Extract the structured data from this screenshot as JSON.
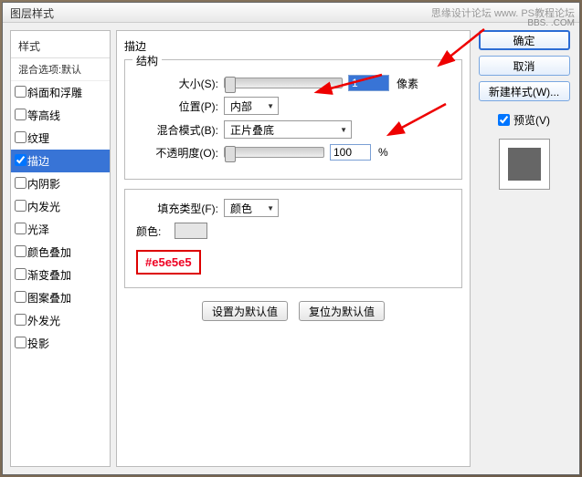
{
  "watermark": "思缘设计论坛  www.  PS教程论坛",
  "watermark2": "BBS.  .COM",
  "title": "图层样式",
  "left": {
    "header": "样式",
    "sub": "混合选项:默认",
    "items": [
      {
        "label": "斜面和浮雕",
        "checked": false
      },
      {
        "label": "等高线",
        "checked": false
      },
      {
        "label": "纹理",
        "checked": false
      },
      {
        "label": "描边",
        "checked": true,
        "selected": true
      },
      {
        "label": "内阴影",
        "checked": false
      },
      {
        "label": "内发光",
        "checked": false
      },
      {
        "label": "光泽",
        "checked": false
      },
      {
        "label": "颜色叠加",
        "checked": false
      },
      {
        "label": "渐变叠加",
        "checked": false
      },
      {
        "label": "图案叠加",
        "checked": false
      },
      {
        "label": "外发光",
        "checked": false
      },
      {
        "label": "投影",
        "checked": false
      }
    ]
  },
  "center": {
    "panel_title": "描边",
    "structure": "结构",
    "size_label": "大小(S):",
    "size_value": "1",
    "size_unit": "像素",
    "position_label": "位置(P):",
    "position_value": "内部",
    "blend_label": "混合模式(B):",
    "blend_value": "正片叠底",
    "opacity_label": "不透明度(O):",
    "opacity_value": "100",
    "opacity_unit": "%",
    "fill_label": "填充类型(F):",
    "fill_value": "颜色",
    "color_label": "颜色:",
    "hex": "#e5e5e5",
    "reset_default": "设置为默认值",
    "restore_default": "复位为默认值"
  },
  "right": {
    "ok": "确定",
    "cancel": "取消",
    "new_style": "新建样式(W)...",
    "preview": "预览(V)"
  }
}
